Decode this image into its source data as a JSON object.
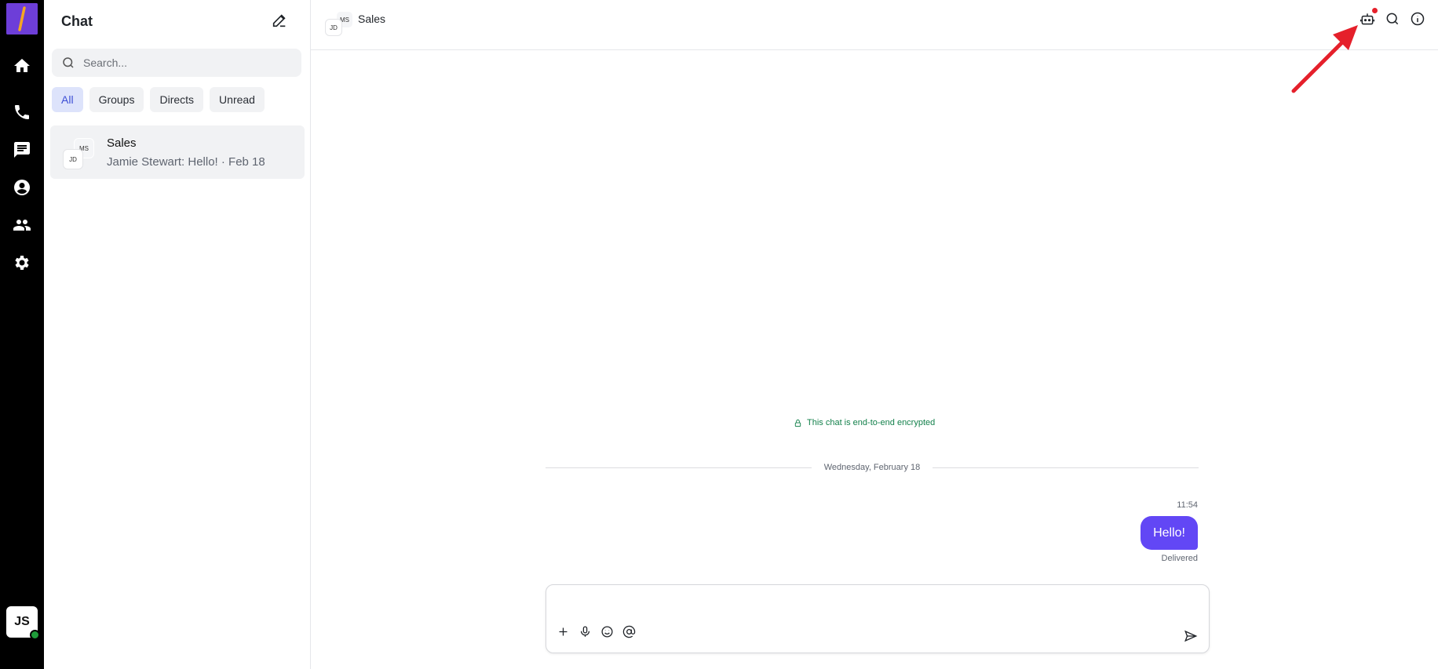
{
  "app": {
    "logo_glyph": "/",
    "accent_color": "#6247f5",
    "logo_color": "#6d3ed8"
  },
  "rail": {
    "items": [
      {
        "icon": "home-icon"
      },
      {
        "icon": "phone-icon"
      },
      {
        "icon": "chat-icon"
      },
      {
        "icon": "account-icon"
      },
      {
        "icon": "people-icon"
      },
      {
        "icon": "gear-icon"
      }
    ],
    "user_initials": "JS",
    "presence_color": "#1f9d3a"
  },
  "sidebar": {
    "title": "Chat",
    "search_placeholder": "Search...",
    "filters": [
      {
        "label": "All",
        "active": true
      },
      {
        "label": "Groups",
        "active": false
      },
      {
        "label": "Directs",
        "active": false
      },
      {
        "label": "Unread",
        "active": false
      }
    ],
    "conversations": [
      {
        "name": "Sales",
        "avatar_front": "JD",
        "avatar_back": "MS",
        "preview": "Jamie Stewart: Hello! · Feb 18"
      }
    ]
  },
  "chat": {
    "title": "Sales",
    "avatar_front": "JD",
    "avatar_back": "MS",
    "header_actions": [
      "bot-icon",
      "search-icon",
      "info-icon"
    ],
    "encryption_notice": "This chat is end-to-end encrypted",
    "day_separator": "Wednesday, February 18",
    "messages": [
      {
        "time": "11:54",
        "text": "Hello!",
        "status": "Delivered"
      }
    ],
    "composer": {
      "placeholder": "",
      "tools": [
        "plus-icon",
        "microphone-icon",
        "emoji-icon",
        "mention-icon"
      ]
    }
  }
}
